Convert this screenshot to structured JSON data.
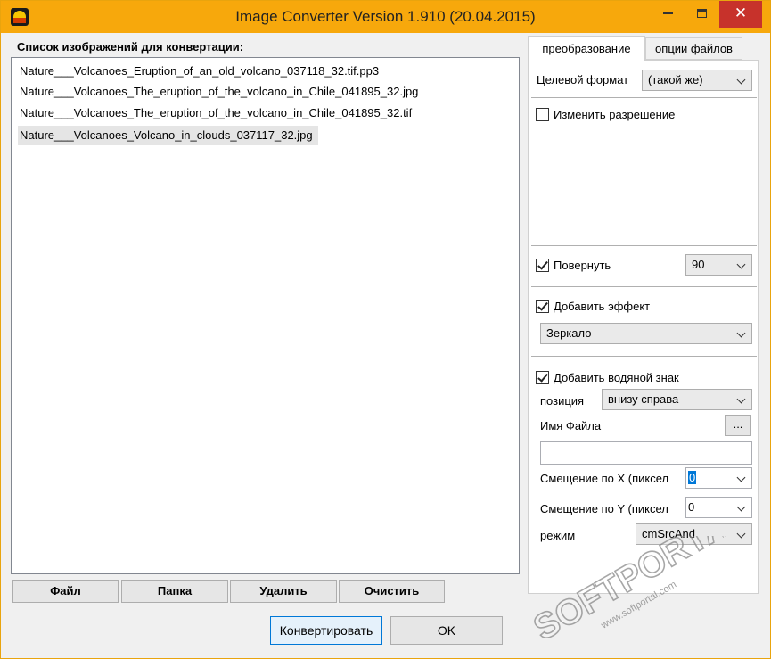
{
  "window": {
    "title": "Image Converter Version 1.910 (20.04.2015)",
    "controls": {
      "minimize": "minimize",
      "maximize": "maximize",
      "close": "✕"
    }
  },
  "list": {
    "title": "Список изображений для конвертации:",
    "items": [
      "Nature___Volcanoes_Eruption_of_an_old_volcano_037118_32.tif.pp3",
      "Nature___Volcanoes_The_eruption_of_the_volcano_in_Chile_041895_32.jpg",
      "Nature___Volcanoes_The_eruption_of_the_volcano_in_Chile_041895_32.tif",
      "Nature___Volcanoes_Volcano_in_clouds_037117_32.jpg"
    ],
    "selected_index": 3
  },
  "list_buttons": {
    "file": "Файл",
    "folder": "Папка",
    "delete": "Удалить",
    "clear": "Очистить"
  },
  "actions": {
    "convert": "Конвертировать",
    "ok": "OK"
  },
  "tabs": {
    "convert": "преобразование",
    "file_options": "опции файлов"
  },
  "settings": {
    "target_format_label": "Целевой формат",
    "target_format_value": "(такой же)",
    "resize_label": "Изменить разрешение",
    "resize_checked": false,
    "rotate_label": "Повернуть",
    "rotate_checked": true,
    "rotate_value": "90",
    "effect_label": "Добавить эффект",
    "effect_checked": true,
    "effect_value": "Зеркало",
    "watermark_label": "Добавить водяной знак",
    "watermark_checked": true,
    "position_label": "позиция",
    "position_value": "внизу справа",
    "filename_label": "Имя Файла",
    "browse_label": "...",
    "filename_value": "",
    "offset_x_label": "Смещение по X (пиксел",
    "offset_x_value": "0",
    "offset_y_label": "Смещение по Y (пиксел",
    "offset_y_value": "0",
    "mode_label": "режим",
    "mode_value": "cmSrcAnd"
  },
  "watermark_overlay": {
    "text": "SOFTPORTAL",
    "url": "www.softportal.com",
    "tm": "™"
  },
  "colors": {
    "titlebar": "#f7a80c",
    "close": "#c7322b",
    "focus": "#0078d7"
  }
}
